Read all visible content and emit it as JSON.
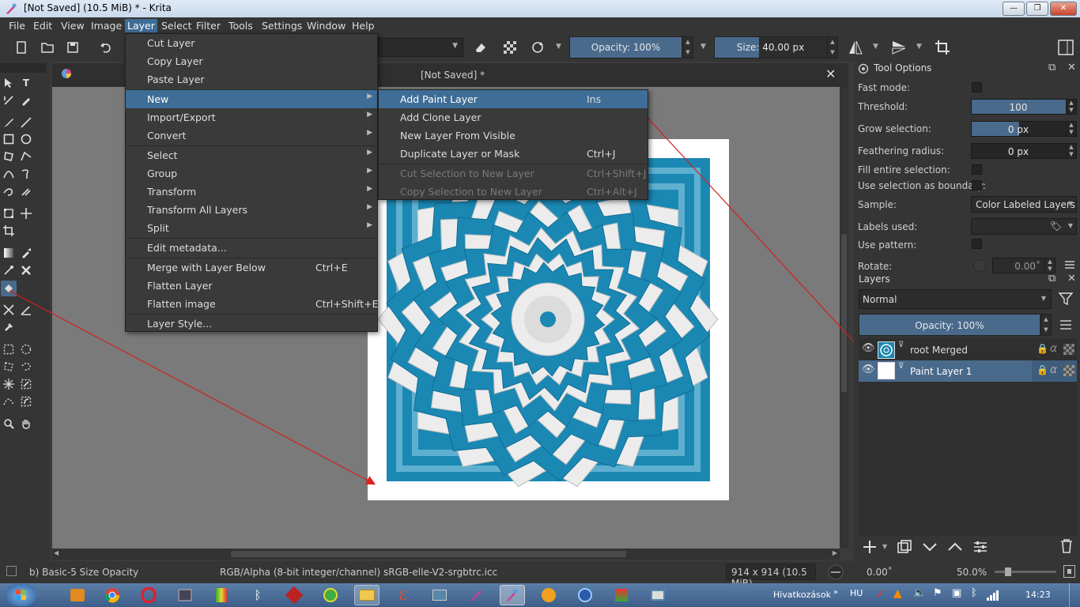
{
  "window": {
    "title": "[Not Saved]  (10.5 MiB)  * - Krita"
  },
  "menubar": {
    "items": [
      "File",
      "Edit",
      "View",
      "Image",
      "Layer",
      "Select",
      "Filter",
      "Tools",
      "Settings",
      "Window",
      "Help"
    ]
  },
  "toolbar": {
    "opacity": "Opacity: 100%",
    "opacity_value": 1.0,
    "size": "Size: 40.00 px",
    "size_fraction": 0.4
  },
  "doc": {
    "tab_title": "[Not Saved]  *"
  },
  "layer_menu": {
    "items": [
      {
        "label": "Cut Layer",
        "shortcut": ""
      },
      {
        "label": "Copy Layer",
        "shortcut": ""
      },
      {
        "label": "Paste Layer",
        "shortcut": ""
      },
      {
        "label": "New",
        "shortcut": "",
        "submenu": true
      },
      {
        "label": "Import/Export",
        "shortcut": "",
        "submenu": true
      },
      {
        "label": "Convert",
        "shortcut": "",
        "submenu": true
      },
      {
        "label": "Select",
        "shortcut": "",
        "submenu": true
      },
      {
        "label": "Group",
        "shortcut": "",
        "submenu": true
      },
      {
        "label": "Transform",
        "shortcut": "",
        "submenu": true
      },
      {
        "label": "Transform All Layers",
        "shortcut": "",
        "submenu": true
      },
      {
        "label": "Split",
        "shortcut": "",
        "submenu": true
      },
      {
        "label": "Edit metadata...",
        "shortcut": ""
      },
      {
        "label": "Merge with Layer Below",
        "shortcut": "Ctrl+E"
      },
      {
        "label": "Flatten Layer",
        "shortcut": ""
      },
      {
        "label": "Flatten image",
        "shortcut": "Ctrl+Shift+E"
      },
      {
        "label": "Layer Style...",
        "shortcut": ""
      }
    ]
  },
  "new_submenu": {
    "items": [
      {
        "label": "Add Paint Layer",
        "shortcut": "Ins"
      },
      {
        "label": "Add Clone Layer",
        "shortcut": ""
      },
      {
        "label": "New Layer From Visible",
        "shortcut": ""
      },
      {
        "label": "Duplicate Layer or Mask",
        "shortcut": "Ctrl+J"
      },
      {
        "label": "Cut Selection to New Layer",
        "shortcut": "Ctrl+Shift+J"
      },
      {
        "label": "Copy Selection to New Layer",
        "shortcut": "Ctrl+Alt+J"
      }
    ]
  },
  "tool_options": {
    "title": "Tool Options",
    "fast_mode": "Fast mode:",
    "threshold_label": "Threshold:",
    "threshold": "100",
    "threshold_fraction": 1.0,
    "grow_label": "Grow selection:",
    "grow": "0 px",
    "grow_fraction": 0.0,
    "feather_label": "Feathering radius:",
    "feather": "0 px",
    "fill_entire": "Fill entire selection:",
    "use_boundary": "Use selection as boundary:",
    "sample_label": "Sample:",
    "sample": "Color Labeled Layers",
    "labels_used": "Labels used:",
    "use_pattern": "Use pattern:",
    "rotate_label": "Rotate:",
    "rotate": "0.00˚"
  },
  "layers": {
    "title": "Layers",
    "blend": "Normal",
    "opacity": "Opacity:  100%",
    "items": [
      {
        "name": "root Merged"
      },
      {
        "name": "Paint Layer 1"
      }
    ]
  },
  "status": {
    "brush": "b) Basic-5 Size Opacity",
    "color": "RGB/Alpha (8-bit integer/channel)  sRGB-elle-V2-srgbtrc.icc",
    "dims": "914 x 914 (10.5 MiB)",
    "rotation": "0.00˚",
    "zoom": "50.0%"
  },
  "taskbar": {
    "label": "Hivatkozások",
    "lang": "HU",
    "time": "14:23"
  },
  "colors": {
    "accent": "#3e6d97",
    "mandala_blue": "#1b88b4",
    "mandala_white": "#ececec"
  }
}
